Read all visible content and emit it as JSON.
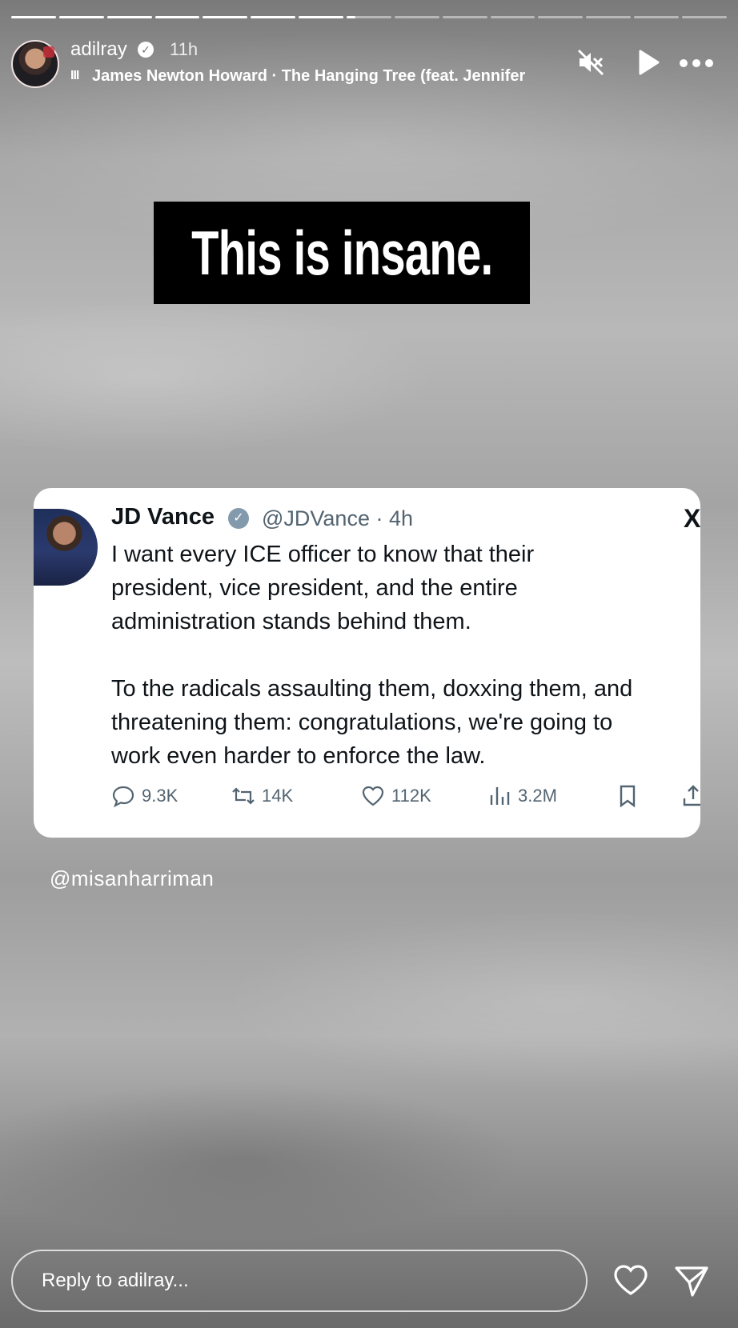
{
  "story": {
    "progress": {
      "total_segments": 15,
      "completed_segments": 7,
      "current_segment_fraction": 0.2
    },
    "username": "adilray",
    "time": "11h",
    "music": "James Newton Howard · The Hanging Tree (feat. Jennifer",
    "icons": {
      "mute": "muted-speaker-icon",
      "play": "play-icon",
      "more": "more-icon"
    }
  },
  "caption": "This is insane.",
  "tweet": {
    "author_name": "JD Vance",
    "handle_time": "@JDVance · 4h",
    "paragraph1": [
      "I want every ICE officer to know that their",
      "president, vice president, and the entire",
      "administration stands behind them."
    ],
    "paragraph2": [
      "To the radicals assaulting them, doxxing them, and",
      "threatening them: congratulations, we're going to",
      "work even harder to enforce the law."
    ],
    "stats": {
      "replies": "9.3K",
      "reposts": "14K",
      "likes": "112K",
      "views": "3.2M"
    }
  },
  "mention": "@misanharriman",
  "footer": {
    "reply_placeholder": "Reply to adilray..."
  },
  "colors": {
    "verified_blue": "#829aab",
    "caption_bg": "#000000"
  }
}
